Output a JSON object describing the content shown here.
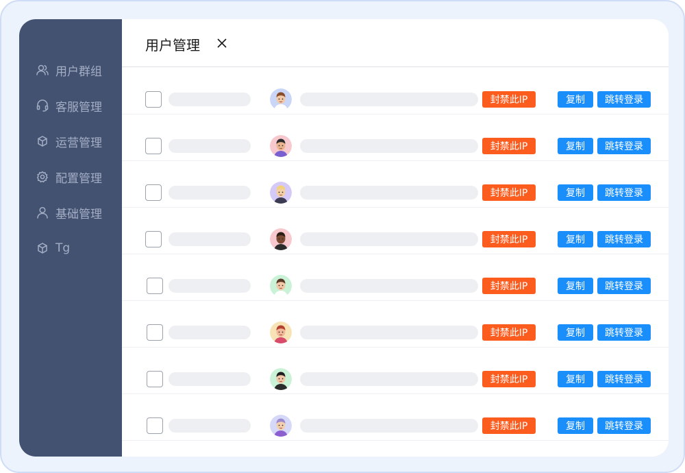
{
  "sidebar": {
    "items": [
      {
        "label": "用户群组",
        "icon": "users-icon"
      },
      {
        "label": "客服管理",
        "icon": "headset-icon"
      },
      {
        "label": "运营管理",
        "icon": "cube-icon"
      },
      {
        "label": "配置管理",
        "icon": "gear-icon"
      },
      {
        "label": "基础管理",
        "icon": "user-icon"
      },
      {
        "label": "Tg",
        "icon": "cube-icon"
      }
    ]
  },
  "header": {
    "title": "用户管理",
    "close_icon": "close-icon"
  },
  "rows": [
    {
      "ban": "封禁此IP",
      "copy": "复制",
      "jump": "跳转登录",
      "avatar_bg": "#c9d6f7",
      "skin": "#f2c9a8",
      "hair": "#8a4b2a",
      "shirt": "#ffffff"
    },
    {
      "ban": "封禁此IP",
      "copy": "复制",
      "jump": "跳转登录",
      "avatar_bg": "#f7c9cf",
      "skin": "#e9b48f",
      "hair": "#2b2b2b",
      "shirt": "#7a5fd0"
    },
    {
      "ban": "封禁此IP",
      "copy": "复制",
      "jump": "跳转登录",
      "avatar_bg": "#d5c9f7",
      "skin": "#f3cfa8",
      "hair": "#f3d27a",
      "shirt": "#3b3b52"
    },
    {
      "ban": "封禁此IP",
      "copy": "复制",
      "jump": "跳转登录",
      "avatar_bg": "#f7c9cf",
      "skin": "#7a4a32",
      "hair": "#2b1d16",
      "shirt": "#2b2b2b"
    },
    {
      "ban": "封禁此IP",
      "copy": "复制",
      "jump": "跳转登录",
      "avatar_bg": "#c9f2d6",
      "skin": "#f2c9a8",
      "hair": "#5a3a28",
      "shirt": "#ffffff"
    },
    {
      "ban": "封禁此IP",
      "copy": "复制",
      "jump": "跳转登录",
      "avatar_bg": "#f7e3b5",
      "skin": "#f2b89a",
      "hair": "#b3412f",
      "shirt": "#d94b6a"
    },
    {
      "ban": "封禁此IP",
      "copy": "复制",
      "jump": "跳转登录",
      "avatar_bg": "#c9f2d6",
      "skin": "#f2c9a8",
      "hair": "#1f1f1f",
      "shirt": "#2b2b2b"
    },
    {
      "ban": "封禁此IP",
      "copy": "复制",
      "jump": "跳转登录",
      "avatar_bg": "#d5d9f7",
      "skin": "#f3cfb0",
      "hair": "#9b8ad0",
      "shirt": "#8c5fd0"
    }
  ],
  "colors": {
    "sidebar_bg": "#445272",
    "ban_button": "#fc5c1e",
    "action_button": "#1a8ffc"
  }
}
